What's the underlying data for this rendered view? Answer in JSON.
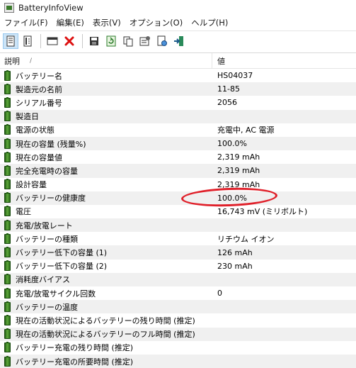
{
  "window": {
    "title": "BatteryInfoView"
  },
  "menu": [
    "ファイル(F)",
    "編集(E)",
    "表示(V)",
    "オプション(O)",
    "ヘルプ(H)"
  ],
  "table": {
    "headers": {
      "description": "説明",
      "sort_indicator": "/",
      "value": "値"
    },
    "rows": [
      {
        "label": "バッテリー名",
        "value": "HS04037"
      },
      {
        "label": "製造元の名前",
        "value": "11-85"
      },
      {
        "label": "シリアル番号",
        "value": "2056"
      },
      {
        "label": "製造日",
        "value": ""
      },
      {
        "label": "電源の状態",
        "value": "充電中, AC 電源"
      },
      {
        "label": "現在の容量 (残量%)",
        "value": "100.0%"
      },
      {
        "label": "現在の容量値",
        "value": "2,319 mAh"
      },
      {
        "label": "完全充電時の容量",
        "value": "2,319 mAh"
      },
      {
        "label": "設計容量",
        "value": "2,319 mAh"
      },
      {
        "label": "バッテリーの健康度",
        "value": "100.0%"
      },
      {
        "label": "電圧",
        "value": "16,743 mV (ミリボルト)"
      },
      {
        "label": "充電/放電レート",
        "value": ""
      },
      {
        "label": "バッテリーの種類",
        "value": "リチウム イオン"
      },
      {
        "label": "バッテリー低下の容量 (1)",
        "value": "126 mAh"
      },
      {
        "label": "バッテリー低下の容量 (2)",
        "value": "230 mAh"
      },
      {
        "label": "消耗度バイアス",
        "value": ""
      },
      {
        "label": "充電/放電サイクル回数",
        "value": "0"
      },
      {
        "label": "バッテリーの温度",
        "value": ""
      },
      {
        "label": "現在の活動状況によるバッテリーの残り時間 (推定)",
        "value": ""
      },
      {
        "label": "現在の活動状況によるバッテリーのフル時間 (推定)",
        "value": ""
      },
      {
        "label": "バッテリー充電の残り時間 (推定)",
        "value": ""
      },
      {
        "label": "バッテリー充電の所要時間 (推定)",
        "value": ""
      }
    ]
  },
  "toolbar_icons": [
    "mode-battery-info-icon",
    "mode-battery-log-icon",
    "window-icon",
    "delete-icon",
    "save-icon",
    "refresh-icon",
    "copy-icon",
    "properties-icon",
    "html-report-icon",
    "exit-icon"
  ],
  "colors": {
    "highlight": "#e0202a",
    "battery_icon": "#3a8a22",
    "row_alt": "#f0f0f0"
  }
}
